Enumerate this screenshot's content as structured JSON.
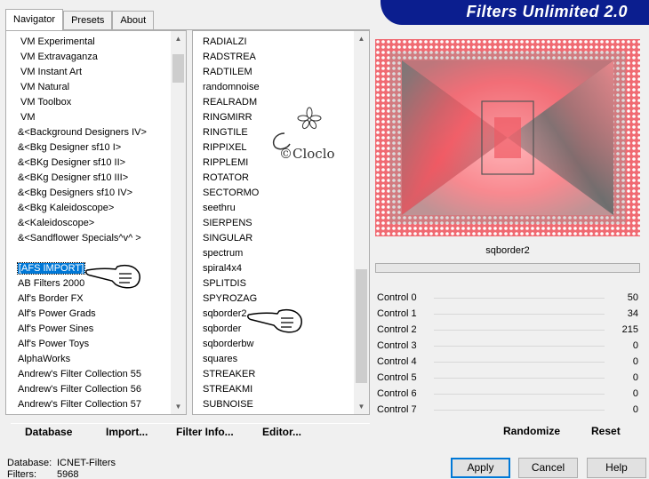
{
  "banner": {
    "title": "Filters Unlimited 2.0"
  },
  "tabs": [
    {
      "label": "Navigator"
    },
    {
      "label": "Presets"
    },
    {
      "label": "About"
    }
  ],
  "categories": [
    {
      "label": "VM Experimental"
    },
    {
      "label": "VM Extravaganza"
    },
    {
      "label": "VM Instant Art"
    },
    {
      "label": "VM Natural"
    },
    {
      "label": "VM Toolbox"
    },
    {
      "label": "VM"
    },
    {
      "label": "&<Background Designers IV>"
    },
    {
      "label": "&<Bkg Designer sf10 I>"
    },
    {
      "label": "&<BKg Designer sf10 II>"
    },
    {
      "label": "&<BKg Designer sf10 III>"
    },
    {
      "label": "&<Bkg Designers sf10 IV>"
    },
    {
      "label": "&<Bkg Kaleidoscope>"
    },
    {
      "label": "&<Kaleidoscope>"
    },
    {
      "label": "&<Sandflower Specials^v^ >"
    },
    {
      "label": ""
    },
    {
      "label": "[AFS IMPORT]"
    },
    {
      "label": "AB Filters 2000"
    },
    {
      "label": "Alf's Border FX"
    },
    {
      "label": "Alf's Power Grads"
    },
    {
      "label": "Alf's Power Sines"
    },
    {
      "label": "Alf's Power Toys"
    },
    {
      "label": "AlphaWorks"
    },
    {
      "label": "Andrew's Filter Collection 55"
    },
    {
      "label": "Andrew's Filter Collection 56"
    },
    {
      "label": "Andrew's Filter Collection 57"
    }
  ],
  "filters": [
    {
      "label": "RADIALZI"
    },
    {
      "label": "RADSTREA"
    },
    {
      "label": "RADTILEM"
    },
    {
      "label": "randomnoise"
    },
    {
      "label": "REALRADM"
    },
    {
      "label": "RINGMIRR"
    },
    {
      "label": "RINGTILE"
    },
    {
      "label": "RIPPIXEL"
    },
    {
      "label": "RIPPLEMI"
    },
    {
      "label": "ROTATOR"
    },
    {
      "label": "SECTORMO"
    },
    {
      "label": "seethru"
    },
    {
      "label": "SIERPENS"
    },
    {
      "label": "SINGULAR"
    },
    {
      "label": "spectrum"
    },
    {
      "label": "spiral4x4"
    },
    {
      "label": "SPLITDIS"
    },
    {
      "label": "SPYROZAG"
    },
    {
      "label": "sqborder2"
    },
    {
      "label": "sqborder"
    },
    {
      "label": "sqborderbw"
    },
    {
      "label": "squares"
    },
    {
      "label": "STREAKER"
    },
    {
      "label": "STREAKMI"
    },
    {
      "label": "SUBNOISE"
    }
  ],
  "selected_filter": "sqborder2",
  "controls": [
    {
      "label": "Control 0",
      "value": "50"
    },
    {
      "label": "Control 1",
      "value": "34"
    },
    {
      "label": "Control 2",
      "value": "215"
    },
    {
      "label": "Control 3",
      "value": "0"
    },
    {
      "label": "Control 4",
      "value": "0"
    },
    {
      "label": "Control 5",
      "value": "0"
    },
    {
      "label": "Control 6",
      "value": "0"
    },
    {
      "label": "Control 7",
      "value": "0"
    }
  ],
  "actions": {
    "database": "Database",
    "import": "Import...",
    "filter_info": "Filter Info...",
    "editor": "Editor...",
    "randomize": "Randomize",
    "reset": "Reset"
  },
  "status": {
    "database_label": "Database:",
    "database_value": "ICNET-Filters",
    "filters_label": "Filters:",
    "filters_value": "5968"
  },
  "buttons": {
    "apply": "Apply",
    "cancel": "Cancel",
    "help": "Help"
  },
  "watermark": "©Cloclo",
  "colors": {
    "banner_bg": "#0b1e8f",
    "selection": "#0078d7",
    "preview_pink": "#f05a64"
  }
}
